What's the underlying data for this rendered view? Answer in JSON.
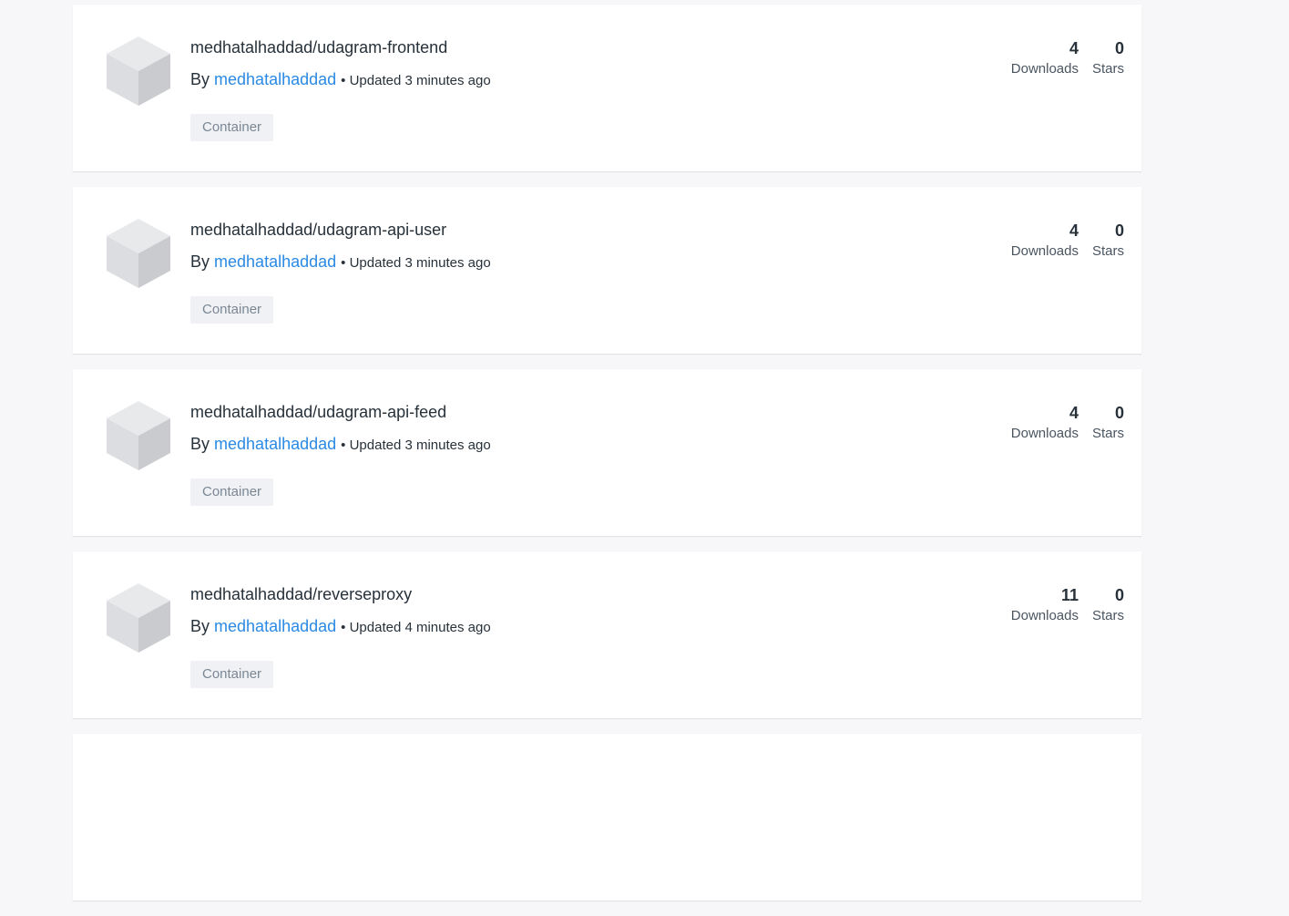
{
  "repos": [
    {
      "name": "medhatalhaddad/udagram-frontend",
      "by_label": "By",
      "author": "medhatalhaddad",
      "updated": "• Updated 3 minutes ago",
      "badge": "Container",
      "downloads": "4",
      "downloads_label": "Downloads",
      "stars": "0",
      "stars_label": "Stars"
    },
    {
      "name": "medhatalhaddad/udagram-api-user",
      "by_label": "By",
      "author": "medhatalhaddad",
      "updated": "• Updated 3 minutes ago",
      "badge": "Container",
      "downloads": "4",
      "downloads_label": "Downloads",
      "stars": "0",
      "stars_label": "Stars"
    },
    {
      "name": "medhatalhaddad/udagram-api-feed",
      "by_label": "By",
      "author": "medhatalhaddad",
      "updated": "• Updated 3 minutes ago",
      "badge": "Container",
      "downloads": "4",
      "downloads_label": "Downloads",
      "stars": "0",
      "stars_label": "Stars"
    },
    {
      "name": "medhatalhaddad/reverseproxy",
      "by_label": "By",
      "author": "medhatalhaddad",
      "updated": "• Updated 4 minutes ago",
      "badge": "Container",
      "downloads": "11",
      "downloads_label": "Downloads",
      "stars": "0",
      "stars_label": "Stars"
    }
  ]
}
